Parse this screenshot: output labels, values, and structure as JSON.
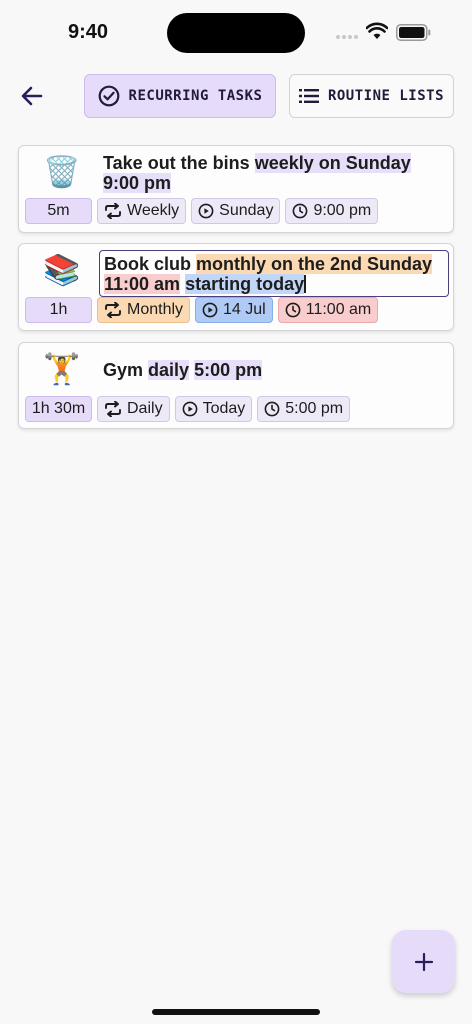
{
  "status_bar": {
    "time": "9:40"
  },
  "header": {
    "back_icon": "arrow-left-icon",
    "tabs": [
      {
        "label": "RECURRING TASKS",
        "icon": "check-circle-icon",
        "active": true
      },
      {
        "label": "ROUTINE LISTS",
        "icon": "list-icon",
        "active": false
      }
    ]
  },
  "tasks": [
    {
      "emoji": "🗑️",
      "title_plain": "Take out the bins ",
      "title_hl1": "weekly on Sunday",
      "title_gap": " ",
      "title_hl2": "9:00 pm",
      "chips": {
        "duration": "5m",
        "repeat": "Weekly",
        "start": "Sunday",
        "time": "9:00 pm"
      }
    },
    {
      "emoji": "📚",
      "title_plain": "Book club ",
      "title_hl_orange": "monthly on the 2nd Sunday",
      "title_hl_pink": "11:00 am",
      "title_gap": " ",
      "title_hl_blue": "starting today",
      "editing": true,
      "chips": {
        "duration": "1h",
        "repeat": "Monthly",
        "start": "14 Jul",
        "time": "11:00 am"
      }
    },
    {
      "emoji": "🏋️",
      "title_plain": "Gym ",
      "title_hl1": "daily",
      "title_gap": " ",
      "title_hl2": "5:00 pm",
      "chips": {
        "duration": "1h 30m",
        "repeat": "Daily",
        "start": "Today",
        "time": "5:00 pm"
      }
    }
  ],
  "fab": {
    "icon": "plus-icon"
  },
  "colors": {
    "accent": "#e6dcfa",
    "orange": "#fbd9b3",
    "pink": "#f9cdcd",
    "blue": "#aecaf5",
    "text_dark": "#231b3a"
  }
}
